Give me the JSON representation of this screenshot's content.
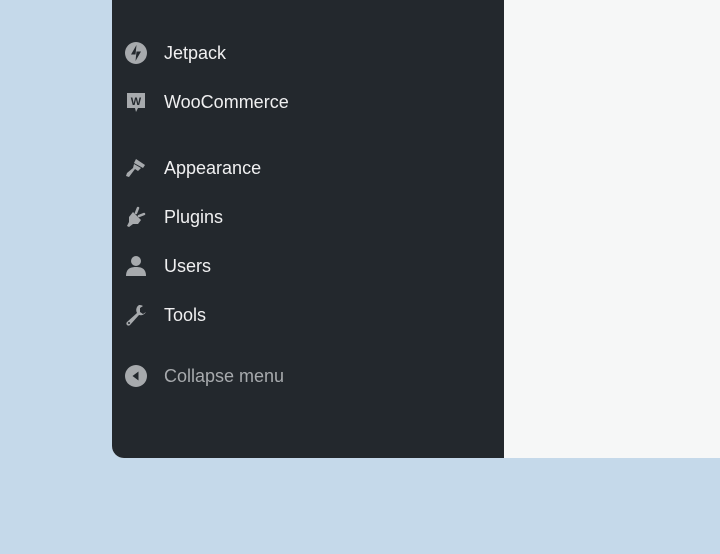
{
  "menu": {
    "items": [
      {
        "label": "Jetpack",
        "icon": "jetpack-icon"
      },
      {
        "label": "WooCommerce",
        "icon": "woocommerce-icon"
      },
      {
        "label": "Appearance",
        "icon": "paintbrush-icon"
      },
      {
        "label": "Plugins",
        "icon": "plugin-icon"
      },
      {
        "label": "Users",
        "icon": "user-icon"
      },
      {
        "label": "Tools",
        "icon": "wrench-icon"
      }
    ],
    "collapse_label": "Collapse menu"
  },
  "colors": {
    "background": "#c5d9ea",
    "sidebar": "#23282d",
    "icon": "#a7aaad",
    "content": "#f6f7f7"
  }
}
